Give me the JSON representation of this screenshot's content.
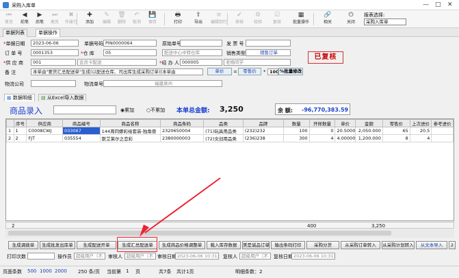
{
  "window": {
    "title": "采购入库单",
    "minimize": "—",
    "maximize": "□",
    "close": "✕"
  },
  "toolbar": {
    "buttons": [
      {
        "label": "首页",
        "glyph": "⏮",
        "enabled": false
      },
      {
        "label": "前笔",
        "glyph": "◀",
        "enabled": true
      },
      {
        "label": "后笔",
        "glyph": "▶",
        "enabled": true
      },
      {
        "label": "尾页",
        "glyph": "⏭",
        "enabled": false
      },
      {
        "label": "作废行",
        "glyph": "✖",
        "enabled": false
      },
      {
        "label": "添加",
        "glyph": "✚",
        "enabled": true
      },
      {
        "label": "编辑",
        "glyph": "✎",
        "enabled": false
      },
      {
        "label": "删除",
        "glyph": "🗑",
        "enabled": false
      },
      {
        "label": "取消",
        "glyph": "↶",
        "enabled": false
      },
      {
        "label": "保存",
        "glyph": "💾",
        "enabled": false
      },
      {
        "label": "打印",
        "glyph": "🖶",
        "enabled": true
      },
      {
        "label": "导出",
        "glyph": "⇪",
        "enabled": true
      },
      {
        "label": "编辑到行",
        "glyph": "≡",
        "enabled": false
      },
      {
        "label": "审核",
        "glyph": "✔",
        "enabled": false
      },
      {
        "label": "校验",
        "glyph": "⚙",
        "enabled": false
      },
      {
        "label": "复核",
        "glyph": "☑",
        "enabled": false
      },
      {
        "label": "批量操作",
        "glyph": "▦",
        "enabled": true
      },
      {
        "label": "相关",
        "glyph": "🔗",
        "enabled": true
      },
      {
        "label": "关闭",
        "glyph": "⏻",
        "enabled": true
      }
    ],
    "report_label": "报表选择:",
    "report_value": "采购入库单"
  },
  "tabs": {
    "list": "单据列表",
    "ops": "单据操作"
  },
  "form": {
    "date_label": "单据日期",
    "date": "2023-06-06",
    "bill_no_label": "单据号码",
    "bill_no": "PIN0000064",
    "orig_no_label": "原始单号",
    "orig_no": "",
    "invoice_label": "发 票 号",
    "invoice": "",
    "order_label": "订 单 号",
    "order": "0001353",
    "wh_label": "仓    库",
    "wh_code": "05",
    "wh_name": "配送中心中转仓库",
    "sales_type_label": "销售类型",
    "sales_type": "销售订单",
    "supplier_label": "供 应 商",
    "supplier_code": "001",
    "supplier_name": "会员卡配送",
    "handler_label": "经 办 人",
    "handler_code": "000005",
    "handler_name": "老杨同学",
    "remark_label": "备    注",
    "remark": "本单由\"要货汇总配送单\"生成(以配送仓库、司出库生成采购订单)[本单由",
    "unit_price_btn": "单价",
    "eq": "=",
    "retail_btn": "零售价",
    "star": "*",
    "pct": "100",
    "pct_btn": "%批量修改",
    "logistics_label": "物流公司",
    "logistics": "",
    "logistics_no_label": "物流单号",
    "logistics_no": "福建泉州",
    "stamp": "已复核"
  },
  "detail_tabs": {
    "detail": "数据明细",
    "excel": "从Excel导入数据"
  },
  "detail": {
    "entry_label": "商品录入",
    "radio_add": "累加",
    "radio_noadd": "不累加",
    "total_label": "本单总金额:",
    "total": "3,250",
    "balance_label": "余 额:",
    "balance": "-96,770,383.59"
  },
  "grid": {
    "headers": [
      "",
      "序号",
      "供应商",
      "商品编号",
      "商品名称",
      "商品条码",
      "品类",
      "品牌",
      "数量",
      "开样数量",
      "单价",
      "金额",
      "零售价",
      "上次进价",
      "参考进价"
    ],
    "rows": [
      [
        "1",
        "1",
        "C0008CWJ",
        "033067",
        "144周同娜彩绘套装-独角兽",
        "2320650004",
        "(71)玩具用品类",
        "(232)232",
        "100",
        "0",
        "20.50000",
        "2,050.000",
        "65",
        "20.5",
        ""
      ],
      [
        "2",
        "2",
        "FJT",
        "035554",
        "斯艾莱尔之恋彩",
        "2380000003",
        "(72)文创用品类",
        "(236)238",
        "300",
        "4",
        "4.000000",
        "1,200.000",
        "8",
        "4",
        ""
      ]
    ],
    "summary": {
      "count": "2",
      "qty": "400",
      "amount": "3,250"
    }
  },
  "actions": [
    "生成调拨单",
    "生成批发出库单",
    "生成配送开单",
    "生成汇总配送单",
    "生成商品价格调整单",
    "载入库存数据",
    "美是诚品订单",
    "输出条码打印",
    "采购分货",
    "从采购订单转入",
    "从采购计划转入",
    "从文本导入",
    "2"
  ],
  "info": {
    "print_count_label": "打印次数",
    "print_count": "",
    "operator_label": "操作员",
    "operator": "超级用户（不",
    "reviewer_label": "审核人",
    "reviewer": "超级用户（不",
    "review_date_label": "审核日期",
    "review_date": "2023-06-06 10:31:00",
    "rechecker_label": "复核人",
    "rechecker": "超级用户（不",
    "recheck_date_label": "复核日期",
    "recheck_date": "2023-06-06 10:31:00"
  },
  "status": {
    "page_size_label": "页面条数",
    "sizes": [
      "500",
      "1000",
      "2000"
    ],
    "per_page": "250 条/页",
    "current_label": "当前第",
    "current": "1",
    "page_unit": "页",
    "total_records": "共7条",
    "total_pages": "共计1页",
    "detail_count": "明细条数：2"
  }
}
